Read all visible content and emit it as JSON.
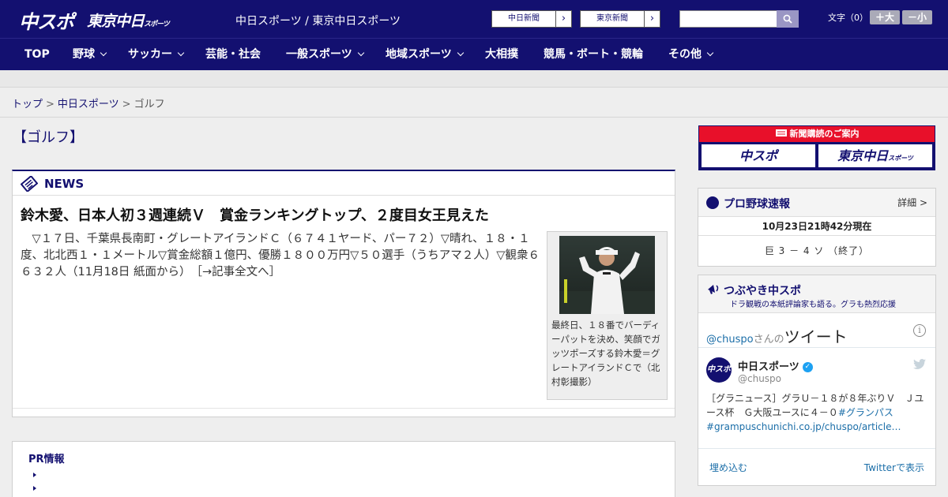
{
  "header": {
    "logo_main": "中スポ",
    "logo_tokyo": "東京中日",
    "logo_tokyo_small": "スポーツ",
    "site_name": "中日スポーツ / 東京中日スポーツ",
    "paper_links": [
      {
        "label": "中日新聞"
      },
      {
        "label": "東京新聞"
      }
    ],
    "search": {
      "placeholder": ""
    },
    "font_size_label": "文字（0）",
    "font_larger": "＋大",
    "font_smaller": "－小",
    "accent_color": "#131070"
  },
  "nav": {
    "items": [
      {
        "label": "TOP",
        "dropdown": false
      },
      {
        "label": "野球",
        "dropdown": true
      },
      {
        "label": "サッカー",
        "dropdown": true
      },
      {
        "label": "芸能・社会",
        "dropdown": false
      },
      {
        "label": "一般スポーツ",
        "dropdown": true
      },
      {
        "label": "地域スポーツ",
        "dropdown": true
      },
      {
        "label": "大相撲",
        "dropdown": false
      },
      {
        "label": "競馬・ボート・競輪",
        "dropdown": false
      },
      {
        "label": "その他",
        "dropdown": true
      }
    ]
  },
  "breadcrumb": {
    "items": [
      "トップ",
      "中日スポーツ",
      "ゴルフ"
    ],
    "separator": ">"
  },
  "page": {
    "title": "【ゴルフ】"
  },
  "news": {
    "label": "NEWS",
    "headline": "鈴木愛、日本人初３週連続Ｖ　賞金ランキングトップ、２度目女王見えた",
    "body": "▽１７日、千葉県長南町・グレートアイランドＣ（６７４１ヤード、パー７２）▽晴れ、１８・１度、北北西１・１メートル▽賞金総額１億円、優勝１８００万円▽５０選手（うちアマ２人）▽観衆６６３２人（11月18日 紙面から）",
    "more_link": "［→記事全文へ］",
    "photo_caption": "最終日、１８番でバーディーパットを決め、笑顔でガッツポーズする鈴木愛＝グレートアイランドＣで（北村彰撮影）"
  },
  "pr": {
    "title": "PR情報"
  },
  "sidebar": {
    "subscribe": {
      "title": "新聞購読のご案内",
      "buttons": [
        "中スポ",
        "東京中日"
      ],
      "button_small": "スポーツ",
      "color": "#e8102a"
    },
    "baseball": {
      "title": "プロ野球速報",
      "detail": "詳細 >",
      "time": "10月23日21時42分現在",
      "score": "巨 3 － 4 ソ （終了）"
    },
    "twitter": {
      "title": "つぶやき中スポ",
      "subtitle": "ドラ観戦の本紙評論家も語る。グラも熱烈応援",
      "handle": "@chuspo",
      "san": "さんの",
      "tweet_word": "ツイート",
      "info": "i",
      "avatar_text": "中スポ",
      "account_name": "中日スポーツ",
      "account_handle": "@chuspo",
      "tweet_text": "［グラニュース］グラＵ－１８が８年ぶりＶ　Ｊユース杯　Ｇ大阪ユースに４－０",
      "tag1": "#グランパス",
      "tag2": "#grampuschunichi.co.jp/chuspo/article…",
      "embed": "埋め込む",
      "view_on_twitter": "Twitterで表示"
    }
  }
}
